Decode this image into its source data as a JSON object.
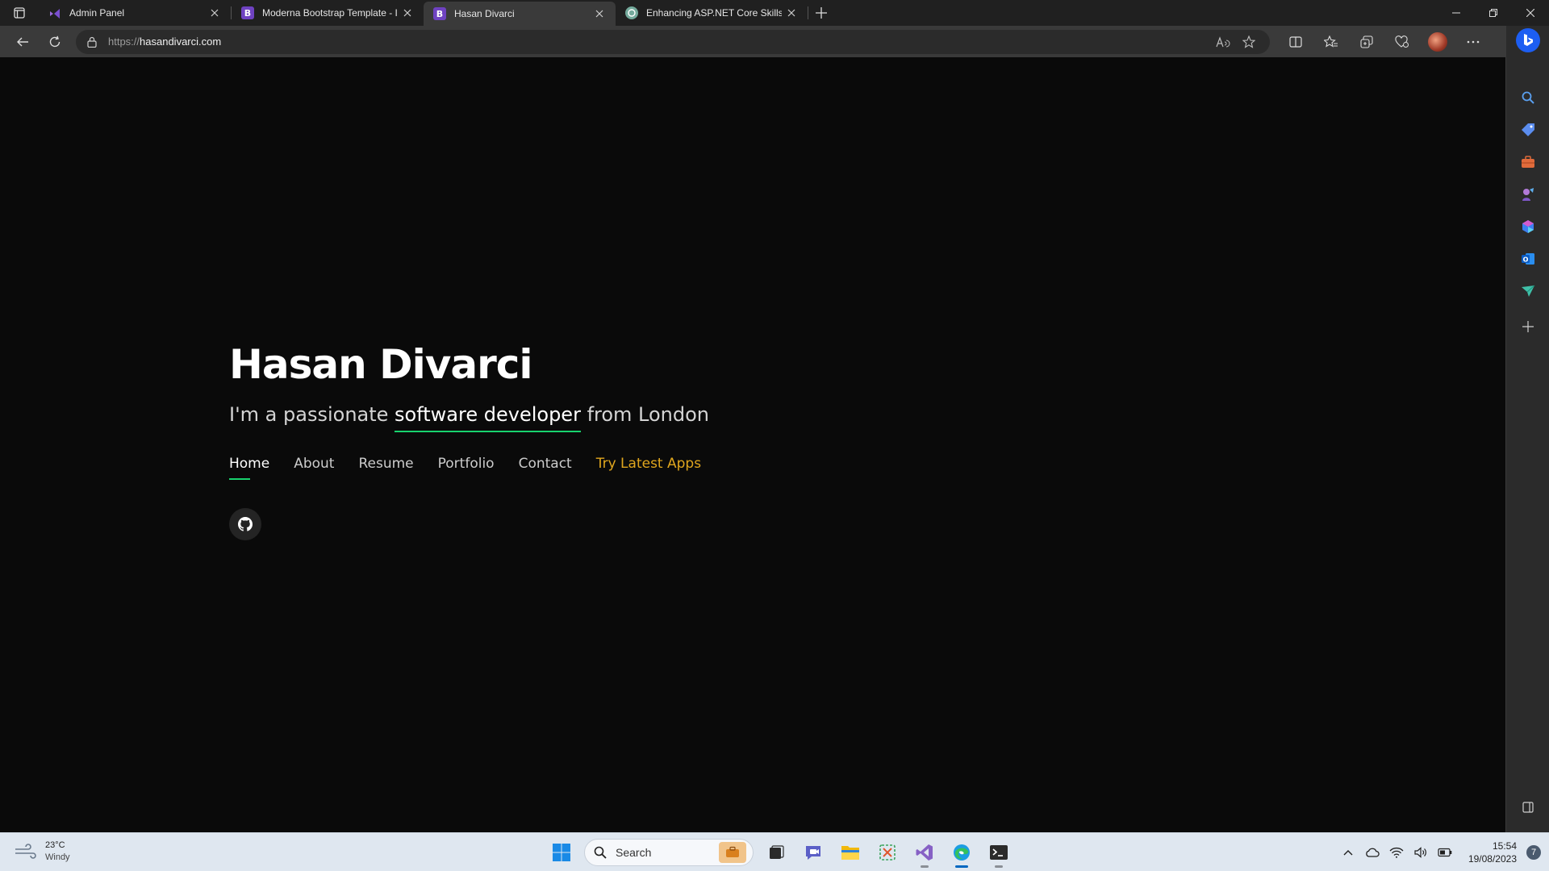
{
  "browser": {
    "tabs": [
      {
        "title": "Admin Panel",
        "favicon": "vs-purple-icon",
        "active": false
      },
      {
        "title": "Moderna Bootstrap Template - In",
        "favicon": "bootstrap-icon",
        "active": false
      },
      {
        "title": "Hasan Divarci",
        "favicon": "bootstrap-icon",
        "active": true
      },
      {
        "title": "Enhancing ASP.NET Core Skills",
        "favicon": "chatgpt-icon",
        "active": false
      }
    ],
    "address": {
      "scheme": "https://",
      "host": "hasandivarci.com"
    }
  },
  "page": {
    "name": "Hasan Divarci",
    "tagline": {
      "prefix": "I'm a passionate ",
      "highlight": "software developer",
      "suffix": " from London"
    },
    "nav": [
      {
        "label": "Home",
        "active": true
      },
      {
        "label": "About"
      },
      {
        "label": "Resume"
      },
      {
        "label": "Portfolio"
      },
      {
        "label": "Contact"
      },
      {
        "label": "Try Latest Apps",
        "accent": true
      }
    ],
    "social": [
      "github-icon"
    ]
  },
  "taskbar": {
    "weather": {
      "temp": "23°C",
      "condition": "Windy"
    },
    "search_label": "Search",
    "clock": {
      "time": "15:54",
      "date": "19/08/2023"
    },
    "notification_count": "7"
  },
  "colors": {
    "page_bg": "#0a0a0a",
    "accent_green": "#18d26e",
    "accent_orange": "#e0a61e"
  }
}
